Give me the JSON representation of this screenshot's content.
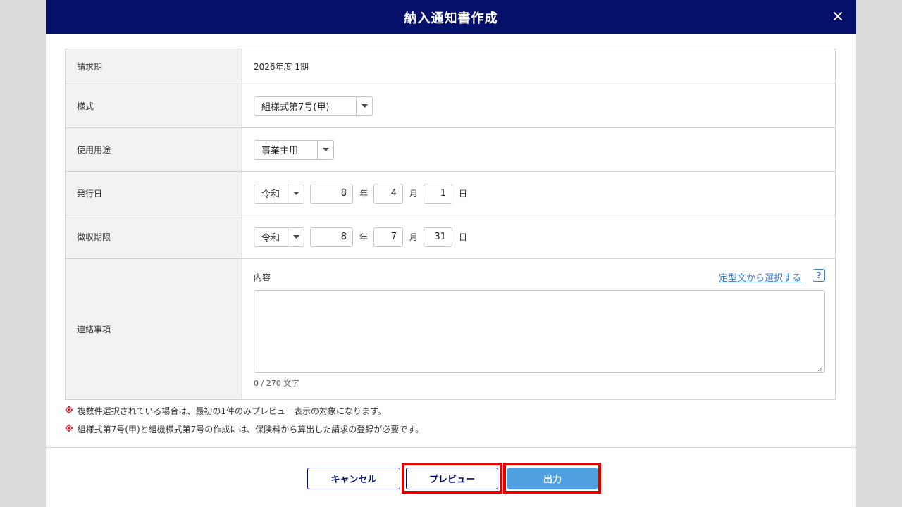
{
  "dialog": {
    "title": "納入通知書作成"
  },
  "form": {
    "billing_period": {
      "label": "請求期",
      "value": "2026年度 1期"
    },
    "format": {
      "label": "様式",
      "selected": "組様式第7号(甲)"
    },
    "usage": {
      "label": "使用用途",
      "selected": "事業主用"
    },
    "issue_date": {
      "label": "発行日",
      "era": "令和",
      "year": "8",
      "year_unit": "年",
      "month": "4",
      "month_unit": "月",
      "day": "1",
      "day_unit": "日"
    },
    "due_date": {
      "label": "徴収期限",
      "era": "令和",
      "year": "8",
      "year_unit": "年",
      "month": "7",
      "month_unit": "月",
      "day": "31",
      "day_unit": "日"
    },
    "contact": {
      "label": "連絡事項",
      "content_label": "内容",
      "template_link": "定型文から選択する",
      "help": "?",
      "value": "",
      "char_count": "0 / 270 文字"
    }
  },
  "notes": [
    {
      "mark": "※",
      "text": "複数件選択されている場合は、最初の1件のみプレビュー表示の対象になります。"
    },
    {
      "mark": "※",
      "text": "組様式第7号(甲)と組機様式第7号の作成には、保険料から算出した請求の登録が必要です。"
    }
  ],
  "footer": {
    "cancel_label": "キャンセル",
    "preview_label": "プレビュー",
    "output_label": "出力"
  },
  "colors": {
    "header_bg": "#04106a",
    "primary_button": "#4fa0e0",
    "link": "#3a7bd5",
    "note_mark": "#d61f2c",
    "highlight": "#e00000"
  }
}
